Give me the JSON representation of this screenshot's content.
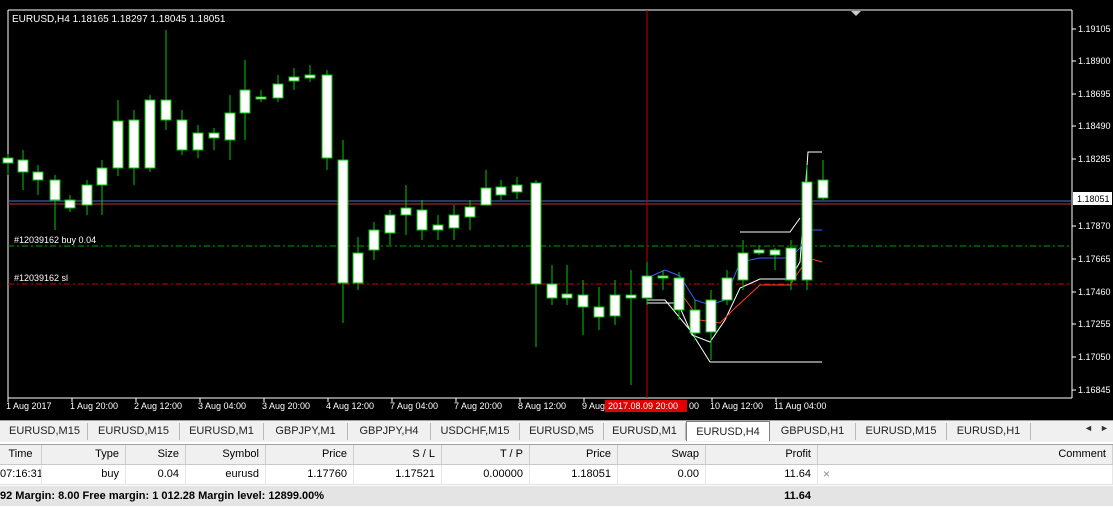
{
  "chart": {
    "title": "EURUSD,H4  1.18165 1.18297 1.18045 1.18051",
    "price_labels": [
      "1.19105",
      "1.18900",
      "1.18695",
      "1.18490",
      "1.18285",
      "1.18051",
      "1.17870",
      "1.17665",
      "1.17460",
      "1.17255",
      "1.17050",
      "1.16845"
    ],
    "current_price": "1.18051",
    "time_labels": [
      "1 Aug 2017",
      "1 Aug 20:00",
      "2 Aug 12:00",
      "3 Aug 04:00",
      "3 Aug 20:00",
      "4 Aug 12:00",
      "7 Aug 04:00",
      "7 Aug 20:00",
      "8 Aug 12:00",
      "9 Aug 04:00",
      "10 Aug 12:00",
      "11 Aug 04:00"
    ],
    "crosshair_time": "2017.08.09 20:00",
    "crosshair_time_tail": "00",
    "order_line_label": "#12039162 buy 0.04",
    "sl_line_label": "#12039162 sl",
    "colors": {
      "background": "#000000",
      "bull_body": "#ffffff",
      "wick": "#00c800",
      "grid": "#333333",
      "order_line": "#00a000",
      "sl_line": "#d00000",
      "bid_line": "#5070c0",
      "crosshair": "#c00000",
      "channel_outer": "#ffffff",
      "channel_mid": "#4060ff",
      "channel_stop": "#ff4020"
    }
  },
  "tabs": {
    "items": [
      "EURUSD,M15",
      "EURUSD,M15",
      "EURUSD,M1",
      "GBPJPY,M1",
      "GBPJPY,H4",
      "USDCHF,M15",
      "EURUSD,M5",
      "EURUSD,M1",
      "EURUSD,H4",
      "GBPUSD,H1",
      "EURUSD,M15",
      "EURUSD,H1"
    ],
    "active_index": 8,
    "arrow_left": "◄",
    "arrow_right": "►"
  },
  "terminal": {
    "headers": [
      "Time",
      "Type",
      "Size",
      "Symbol",
      "Price",
      "S / L",
      "T / P",
      "Price",
      "Swap",
      "Profit",
      "Comment"
    ],
    "row": [
      "07:16:31",
      "buy",
      "0.04",
      "eurusd",
      "1.17760",
      "1.17521",
      "0.00000",
      "1.18051",
      "0.00",
      "11.64",
      ""
    ],
    "close_symbol": "×",
    "summary": "92  Margin: 8.00  Free margin: 1 012.28  Margin level: 12899.00%",
    "summary_profit": "11.64"
  }
}
